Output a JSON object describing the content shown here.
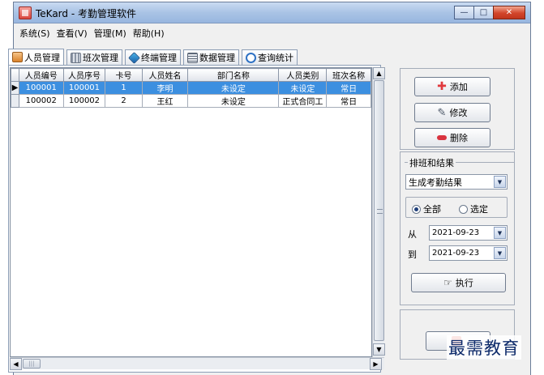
{
  "window": {
    "title": "TeKard - 考勤管理软件",
    "minimize": "—",
    "maximize": "□",
    "close": "✕"
  },
  "menu": [
    {
      "label": "系统(S)"
    },
    {
      "label": "查看(V)"
    },
    {
      "label": "管理(M)"
    },
    {
      "label": "帮助(H)"
    }
  ],
  "tabs": [
    {
      "label": "人员管理",
      "icon": "person-icon"
    },
    {
      "label": "班次管理",
      "icon": "shift-calendar-icon"
    },
    {
      "label": "终端管理",
      "icon": "terminal-icon"
    },
    {
      "label": "数据管理",
      "icon": "data-icon"
    },
    {
      "label": "查询统计",
      "icon": "query-icon"
    }
  ],
  "grid": {
    "columns": [
      "人员编号",
      "人员序号",
      "卡号",
      "人员姓名",
      "部门名称",
      "人员类别",
      "班次名称"
    ],
    "rows": [
      [
        "100001",
        "100001",
        "1",
        "李明",
        "未设定",
        "未设定",
        "常日"
      ],
      [
        "100002",
        "100002",
        "2",
        "王红",
        "未设定",
        "正式合同工",
        "常日"
      ]
    ],
    "selected_row": 0,
    "row_marker": "▶"
  },
  "actions": {
    "add": "添加",
    "edit": "修改",
    "delete": "删除"
  },
  "schedule": {
    "group_title": "排班和结果",
    "mode_value": "生成考勤结果",
    "radio_all": "全部",
    "radio_selected": "选定",
    "radio_all_checked": true,
    "from_label": "从",
    "to_label": "到",
    "from_date": "2021-09-23",
    "to_date": "2021-09-23",
    "execute": "执行"
  },
  "watermark": "最需教育",
  "colors": {
    "selection": "#3c8fe0",
    "add_icon": "#e0393d",
    "delete_icon": "#d9333f"
  }
}
